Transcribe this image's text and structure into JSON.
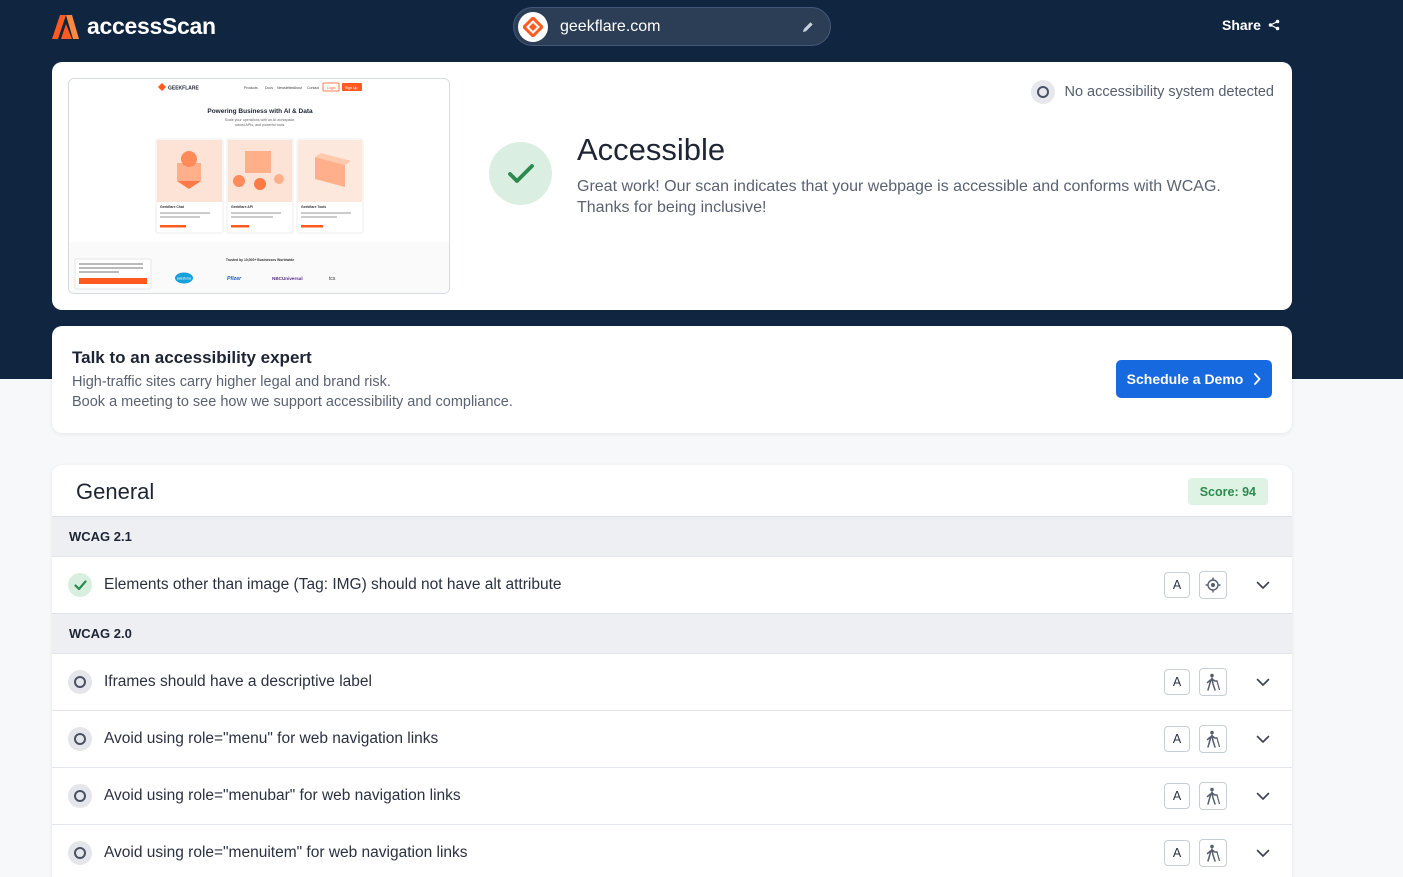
{
  "app": {
    "name": "accessScan"
  },
  "header": {
    "url": "geekflare.com",
    "share_label": "Share"
  },
  "result": {
    "detection_text": "No accessibility system detected",
    "status_title": "Accessible",
    "status_line1": "Great work! Our scan indicates that your webpage is accessible and conforms with WCAG.",
    "status_line2": "Thanks for being inclusive!"
  },
  "thumbnail": {
    "brand": "GEEKFLARE",
    "nav": [
      "Products",
      "Docs",
      "Newsletter",
      "About",
      "Contact"
    ],
    "login": "Login",
    "signup": "Sign Up",
    "headline": "Powering Business with AI & Data",
    "subline1": "Scale your operations with an AI workspace,",
    "subline2": "robust APIs, and powerful tools.",
    "cards": [
      "Geekflare Chat",
      "Geekflare API",
      "Geekflare Tools"
    ],
    "trusted": "Trusted by 10,000+ Businesses Worldwide",
    "logos": [
      "salesforce",
      "Pfizer",
      "NBCUniversal",
      "tcs"
    ]
  },
  "expert": {
    "title": "Talk to an accessibility expert",
    "line1": "High-traffic sites carry higher legal and brand risk.",
    "line2": "Book a meeting to see how we support accessibility and compliance.",
    "button_label": "Schedule a Demo"
  },
  "general": {
    "title": "General",
    "score_label": "Score: 94",
    "groups": [
      {
        "name": "WCAG 2.1",
        "rules": [
          {
            "text": "Elements other than image (Tag: IMG) should not have alt attribute",
            "level": "A",
            "status": "pass",
            "icon": "target-icon"
          }
        ]
      },
      {
        "name": "WCAG 2.0",
        "rules": [
          {
            "text": "Iframes should have a descriptive label",
            "level": "A",
            "status": "not-applicable",
            "icon": "blind-person-icon"
          },
          {
            "text": "Avoid using role=\"menu\" for web navigation links",
            "level": "A",
            "status": "not-applicable",
            "icon": "blind-person-icon"
          },
          {
            "text": "Avoid using role=\"menubar\" for web navigation links",
            "level": "A",
            "status": "not-applicable",
            "icon": "blind-person-icon"
          },
          {
            "text": "Avoid using role=\"menuitem\" for web navigation links",
            "level": "A",
            "status": "not-applicable",
            "icon": "blind-person-icon"
          }
        ]
      }
    ]
  },
  "colors": {
    "header_bg": "#0f2540",
    "brand_orange": "#ff5a1f",
    "primary_blue": "#1769e0",
    "pass_green": "#2d8a4e"
  }
}
